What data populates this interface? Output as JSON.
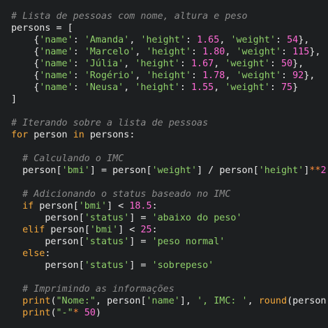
{
  "editor": {
    "language": "python",
    "colors": {
      "background": "#1d1f21",
      "comment": "#8c8c8c",
      "keyword": "#f4a83b",
      "string": "#8fd06a",
      "number": "#ff6ad5",
      "identifier": "#e8e8e8",
      "operator": "#ff8c3a"
    },
    "lines": [
      [
        {
          "t": "comment",
          "v": "# Lista de pessoas com nome, altura e peso"
        }
      ],
      [
        {
          "t": "ident",
          "v": "persons"
        },
        {
          "t": "punct",
          "v": " = ["
        }
      ],
      [
        {
          "t": "punct",
          "v": "    {"
        },
        {
          "t": "string",
          "v": "'name'"
        },
        {
          "t": "punct",
          "v": ": "
        },
        {
          "t": "string",
          "v": "'Amanda'"
        },
        {
          "t": "punct",
          "v": ", "
        },
        {
          "t": "string",
          "v": "'height'"
        },
        {
          "t": "punct",
          "v": ": "
        },
        {
          "t": "number",
          "v": "1.65"
        },
        {
          "t": "punct",
          "v": ", "
        },
        {
          "t": "string",
          "v": "'weight'"
        },
        {
          "t": "punct",
          "v": ": "
        },
        {
          "t": "number",
          "v": "54"
        },
        {
          "t": "punct",
          "v": "},"
        }
      ],
      [
        {
          "t": "punct",
          "v": "    {"
        },
        {
          "t": "string",
          "v": "'name'"
        },
        {
          "t": "punct",
          "v": ": "
        },
        {
          "t": "string",
          "v": "'Marcelo'"
        },
        {
          "t": "punct",
          "v": ", "
        },
        {
          "t": "string",
          "v": "'height'"
        },
        {
          "t": "punct",
          "v": ": "
        },
        {
          "t": "number",
          "v": "1.80"
        },
        {
          "t": "punct",
          "v": ", "
        },
        {
          "t": "string",
          "v": "'weight'"
        },
        {
          "t": "punct",
          "v": ": "
        },
        {
          "t": "number",
          "v": "115"
        },
        {
          "t": "punct",
          "v": "},"
        }
      ],
      [
        {
          "t": "punct",
          "v": "    {"
        },
        {
          "t": "string",
          "v": "'name'"
        },
        {
          "t": "punct",
          "v": ": "
        },
        {
          "t": "string",
          "v": "'Júlia'"
        },
        {
          "t": "punct",
          "v": ", "
        },
        {
          "t": "string",
          "v": "'height'"
        },
        {
          "t": "punct",
          "v": ": "
        },
        {
          "t": "number",
          "v": "1.67"
        },
        {
          "t": "punct",
          "v": ", "
        },
        {
          "t": "string",
          "v": "'weight'"
        },
        {
          "t": "punct",
          "v": ": "
        },
        {
          "t": "number",
          "v": "50"
        },
        {
          "t": "punct",
          "v": "},"
        }
      ],
      [
        {
          "t": "punct",
          "v": "    {"
        },
        {
          "t": "string",
          "v": "'name'"
        },
        {
          "t": "punct",
          "v": ": "
        },
        {
          "t": "string",
          "v": "'Rogério'"
        },
        {
          "t": "punct",
          "v": ", "
        },
        {
          "t": "string",
          "v": "'height'"
        },
        {
          "t": "punct",
          "v": ": "
        },
        {
          "t": "number",
          "v": "1.78"
        },
        {
          "t": "punct",
          "v": ", "
        },
        {
          "t": "string",
          "v": "'weight'"
        },
        {
          "t": "punct",
          "v": ": "
        },
        {
          "t": "number",
          "v": "92"
        },
        {
          "t": "punct",
          "v": "},"
        }
      ],
      [
        {
          "t": "punct",
          "v": "    {"
        },
        {
          "t": "string",
          "v": "'name'"
        },
        {
          "t": "punct",
          "v": ": "
        },
        {
          "t": "string",
          "v": "'Neusa'"
        },
        {
          "t": "punct",
          "v": ", "
        },
        {
          "t": "string",
          "v": "'height'"
        },
        {
          "t": "punct",
          "v": ": "
        },
        {
          "t": "number",
          "v": "1.55"
        },
        {
          "t": "punct",
          "v": ", "
        },
        {
          "t": "string",
          "v": "'weight'"
        },
        {
          "t": "punct",
          "v": ": "
        },
        {
          "t": "number",
          "v": "75"
        },
        {
          "t": "punct",
          "v": "}"
        }
      ],
      [
        {
          "t": "punct",
          "v": "]"
        }
      ],
      [],
      [
        {
          "t": "comment",
          "v": "# Iterando sobre a lista de pessoas"
        }
      ],
      [
        {
          "t": "keyword",
          "v": "for"
        },
        {
          "t": "ident",
          "v": " person "
        },
        {
          "t": "keyword",
          "v": "in"
        },
        {
          "t": "ident",
          "v": " persons"
        },
        {
          "t": "punct",
          "v": ":"
        }
      ],
      [],
      [
        {
          "t": "comment",
          "v": "  # Calculando o IMC"
        }
      ],
      [
        {
          "t": "ident",
          "v": "  person"
        },
        {
          "t": "punct",
          "v": "["
        },
        {
          "t": "string",
          "v": "'bmi'"
        },
        {
          "t": "punct",
          "v": "] = "
        },
        {
          "t": "ident",
          "v": "person"
        },
        {
          "t": "punct",
          "v": "["
        },
        {
          "t": "string",
          "v": "'weight'"
        },
        {
          "t": "punct",
          "v": "] / "
        },
        {
          "t": "ident",
          "v": "person"
        },
        {
          "t": "punct",
          "v": "["
        },
        {
          "t": "string",
          "v": "'height'"
        },
        {
          "t": "punct",
          "v": "]"
        },
        {
          "t": "op",
          "v": "**"
        },
        {
          "t": "number",
          "v": "2"
        }
      ],
      [],
      [
        {
          "t": "comment",
          "v": "  # Adicionando o status baseado no IMC"
        }
      ],
      [
        {
          "t": "keyword",
          "v": "  if"
        },
        {
          "t": "ident",
          "v": " person"
        },
        {
          "t": "punct",
          "v": "["
        },
        {
          "t": "string",
          "v": "'bmi'"
        },
        {
          "t": "punct",
          "v": "] < "
        },
        {
          "t": "number",
          "v": "18.5"
        },
        {
          "t": "punct",
          "v": ":"
        }
      ],
      [
        {
          "t": "ident",
          "v": "      person"
        },
        {
          "t": "punct",
          "v": "["
        },
        {
          "t": "string",
          "v": "'status'"
        },
        {
          "t": "punct",
          "v": "] = "
        },
        {
          "t": "string",
          "v": "'abaixo do peso'"
        }
      ],
      [
        {
          "t": "keyword",
          "v": "  elif"
        },
        {
          "t": "ident",
          "v": " person"
        },
        {
          "t": "punct",
          "v": "["
        },
        {
          "t": "string",
          "v": "'bmi'"
        },
        {
          "t": "punct",
          "v": "] < "
        },
        {
          "t": "number",
          "v": "25"
        },
        {
          "t": "punct",
          "v": ":"
        }
      ],
      [
        {
          "t": "ident",
          "v": "      person"
        },
        {
          "t": "punct",
          "v": "["
        },
        {
          "t": "string",
          "v": "'status'"
        },
        {
          "t": "punct",
          "v": "] = "
        },
        {
          "t": "string",
          "v": "'peso normal'"
        }
      ],
      [
        {
          "t": "keyword",
          "v": "  else"
        },
        {
          "t": "punct",
          "v": ":"
        }
      ],
      [
        {
          "t": "ident",
          "v": "      person"
        },
        {
          "t": "punct",
          "v": "["
        },
        {
          "t": "string",
          "v": "'status'"
        },
        {
          "t": "punct",
          "v": "] = "
        },
        {
          "t": "string",
          "v": "'sobrepeso'"
        }
      ],
      [],
      [
        {
          "t": "comment",
          "v": "  # Imprimindo as informações"
        }
      ],
      [
        {
          "t": "keyword",
          "v": "  print"
        },
        {
          "t": "punct",
          "v": "("
        },
        {
          "t": "string",
          "v": "\"Nome:\""
        },
        {
          "t": "punct",
          "v": ", "
        },
        {
          "t": "ident",
          "v": "person"
        },
        {
          "t": "punct",
          "v": "["
        },
        {
          "t": "string",
          "v": "'name'"
        },
        {
          "t": "punct",
          "v": "], "
        },
        {
          "t": "string",
          "v": "', IMC: '"
        },
        {
          "t": "punct",
          "v": ", "
        },
        {
          "t": "keyword",
          "v": "round"
        },
        {
          "t": "punct",
          "v": "("
        },
        {
          "t": "ident",
          "v": "person"
        },
        {
          "t": "punct",
          "v": "["
        }
      ],
      [
        {
          "t": "keyword",
          "v": "  print"
        },
        {
          "t": "punct",
          "v": "("
        },
        {
          "t": "string",
          "v": "\"-\""
        },
        {
          "t": "op",
          "v": "*"
        },
        {
          "t": "punct",
          "v": " "
        },
        {
          "t": "number",
          "v": "50"
        },
        {
          "t": "punct",
          "v": ")"
        }
      ]
    ]
  }
}
